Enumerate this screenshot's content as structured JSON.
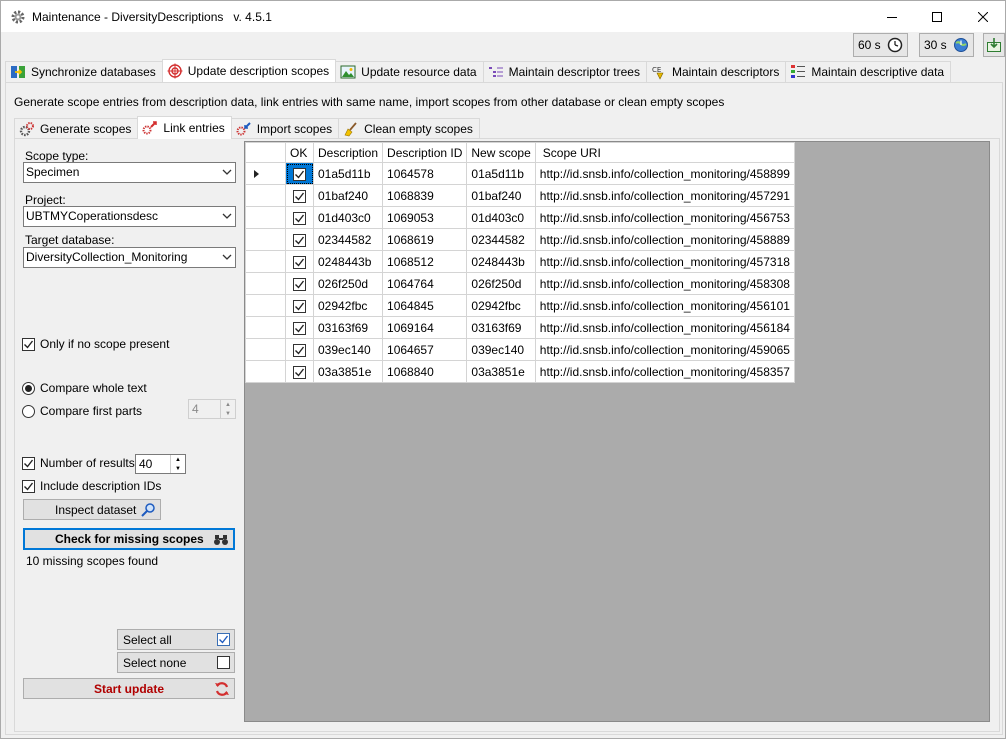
{
  "window": {
    "title": "Maintenance - DiversityDescriptions   v. 4.5.1"
  },
  "toolbar": {
    "timer1": "60 s",
    "timer2": "30 s"
  },
  "main_tabs": [
    {
      "label": "Synchronize databases",
      "icon": "sync-icon"
    },
    {
      "label": "Update description scopes",
      "icon": "target-icon",
      "active": true
    },
    {
      "label": "Update resource data",
      "icon": "image-icon"
    },
    {
      "label": "Maintain descriptor trees",
      "icon": "tree-icon"
    },
    {
      "label": "Maintain descriptors",
      "icon": "descriptor-icon"
    },
    {
      "label": "Maintain descriptive data",
      "icon": "data-icon"
    }
  ],
  "description": "Generate scope entries from description data, link entries with same name, import scopes from other database or clean empty scopes",
  "sub_tabs": [
    {
      "label": "Generate scopes",
      "icon": "gears-icon"
    },
    {
      "label": "Link entries",
      "icon": "link-icon",
      "active": true
    },
    {
      "label": "Import scopes",
      "icon": "import-icon"
    },
    {
      "label": "Clean empty scopes",
      "icon": "broom-icon"
    }
  ],
  "form": {
    "scope_type_label": "Scope type:",
    "scope_type_value": "Specimen",
    "project_label": "Project:",
    "project_value": "UBTMYCoperationsdesc",
    "target_db_label": "Target database:",
    "target_db_value": "DiversityCollection_Monitoring",
    "only_if_no_scope": "Only if no scope present",
    "compare_whole": "Compare whole text",
    "compare_first": "Compare first parts",
    "first_parts_value": "4",
    "number_of_results_label": "Number of results:",
    "number_of_results_value": "40",
    "include_ids": "Include description IDs",
    "inspect_button": "Inspect dataset",
    "check_button": "Check for missing scopes",
    "status": "10 missing scopes found",
    "select_all": "Select all",
    "select_none": "Select none",
    "start_update": "Start update"
  },
  "grid": {
    "columns": [
      "OK",
      "Description",
      "Description ID",
      "New scope",
      "Scope URI"
    ],
    "rows": [
      [
        "01a5d11b",
        "1064578",
        "01a5d11b",
        "http://id.snsb.info/collection_monitoring/458899"
      ],
      [
        "01baf240",
        "1068839",
        "01baf240",
        "http://id.snsb.info/collection_monitoring/457291"
      ],
      [
        "01d403c0",
        "1069053",
        "01d403c0",
        "http://id.snsb.info/collection_monitoring/456753"
      ],
      [
        "02344582",
        "1068619",
        "02344582",
        "http://id.snsb.info/collection_monitoring/458889"
      ],
      [
        "0248443b",
        "1068512",
        "0248443b",
        "http://id.snsb.info/collection_monitoring/457318"
      ],
      [
        "026f250d",
        "1064764",
        "026f250d",
        "http://id.snsb.info/collection_monitoring/458308"
      ],
      [
        "02942fbc",
        "1064845",
        "02942fbc",
        "http://id.snsb.info/collection_monitoring/456101"
      ],
      [
        "03163f69",
        "1069164",
        "03163f69",
        "http://id.snsb.info/collection_monitoring/456184"
      ],
      [
        "039ec140",
        "1064657",
        "039ec140",
        "http://id.snsb.info/collection_monitoring/459065"
      ],
      [
        "03a3851e",
        "1068840",
        "03a3851e",
        "http://id.snsb.info/collection_monitoring/458357"
      ]
    ]
  }
}
